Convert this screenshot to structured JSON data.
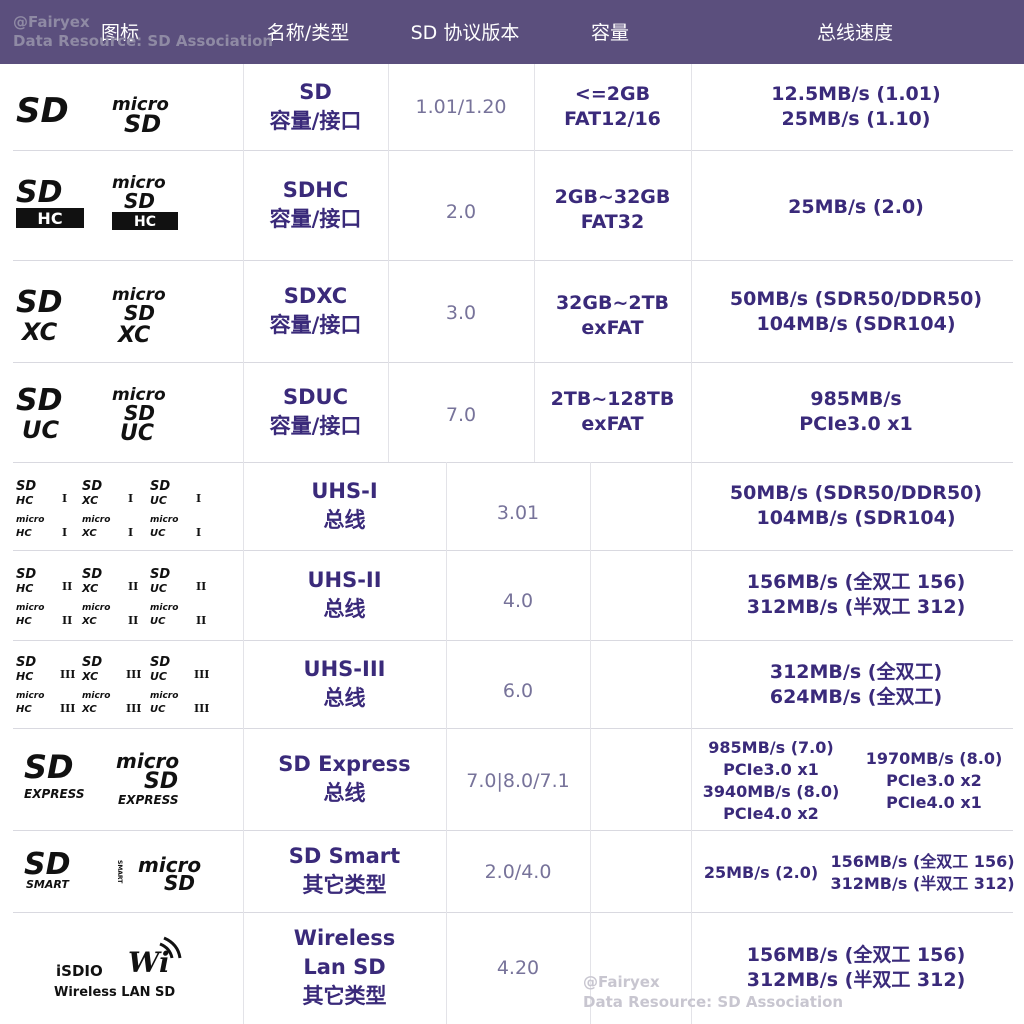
{
  "header": {
    "col_icon": "图标",
    "col_name": "名称/类型",
    "col_version": "SD 协议版本",
    "col_capacity": "容量",
    "col_speed": "总线速度"
  },
  "watermark": {
    "author": "@Fairyex",
    "source": "Data Resource: SD Association"
  },
  "icons": {
    "sd_logo": "SD",
    "micro": "micro",
    "hc": "HC",
    "xc": "XC",
    "uc": "UC",
    "uhs_1": "I",
    "uhs_2": "II",
    "uhs_3": "III",
    "express": "EXPRESS",
    "smart": "SMART",
    "isdio": "iSDIO",
    "wireless_lan": "Wireless LAN SD",
    "wifi": "Wi"
  },
  "rows": [
    {
      "name": "SD",
      "type": "容量/接口",
      "version": "1.01/1.20",
      "capacity_1": "<=2GB",
      "capacity_2": "FAT12/16",
      "speed_1": "12.5MB/s (1.01)",
      "speed_2": "25MB/s (1.10)"
    },
    {
      "name": "SDHC",
      "type": "容量/接口",
      "version": "2.0",
      "capacity_1": "2GB~32GB",
      "capacity_2": "FAT32",
      "speed_1": "25MB/s (2.0)"
    },
    {
      "name": "SDXC",
      "type": "容量/接口",
      "version": "3.0",
      "capacity_1": "32GB~2TB",
      "capacity_2": "exFAT",
      "speed_1": "50MB/s (SDR50/DDR50)",
      "speed_2": "104MB/s (SDR104)"
    },
    {
      "name": "SDUC",
      "type": "容量/接口",
      "version": "7.0",
      "capacity_1": "2TB~128TB",
      "capacity_2": "exFAT",
      "speed_1": "985MB/s",
      "speed_2": "PCIe3.0 x1"
    },
    {
      "name": "UHS-I",
      "type": "总线",
      "version": "3.01",
      "speed_1": "50MB/s (SDR50/DDR50)",
      "speed_2": "104MB/s (SDR104)"
    },
    {
      "name": "UHS-II",
      "type": "总线",
      "version": "4.0",
      "speed_1": "156MB/s (全双工 156)",
      "speed_2": "312MB/s (半双工 312)"
    },
    {
      "name": "UHS-III",
      "type": "总线",
      "version": "6.0",
      "speed_1": "312MB/s (全双工)",
      "speed_2": "624MB/s (全双工)"
    },
    {
      "name": "SD Express",
      "type": "总线",
      "version": "7.0|8.0/7.1",
      "speed_a1": "985MB/s (7.0)",
      "speed_a2": "PCIe3.0 x1",
      "speed_a3": "3940MB/s (8.0)",
      "speed_a4": "PCIe4.0 x2",
      "speed_b1": "1970MB/s (8.0)",
      "speed_b2": "PCIe3.0 x2",
      "speed_b3": "PCIe4.0 x1"
    },
    {
      "name": "SD Smart",
      "type": "其它类型",
      "version": "2.0/4.0",
      "speed_a1": "25MB/s (2.0)",
      "speed_b1": "156MB/s (全双工 156)",
      "speed_b2": "312MB/s (半双工 312)"
    },
    {
      "name_1": "Wireless",
      "name_2": "Lan SD",
      "type": "其它类型",
      "version": "4.20",
      "speed_1": "156MB/s (全双工 156)",
      "speed_2": "312MB/s (半双工 312)"
    }
  ]
}
